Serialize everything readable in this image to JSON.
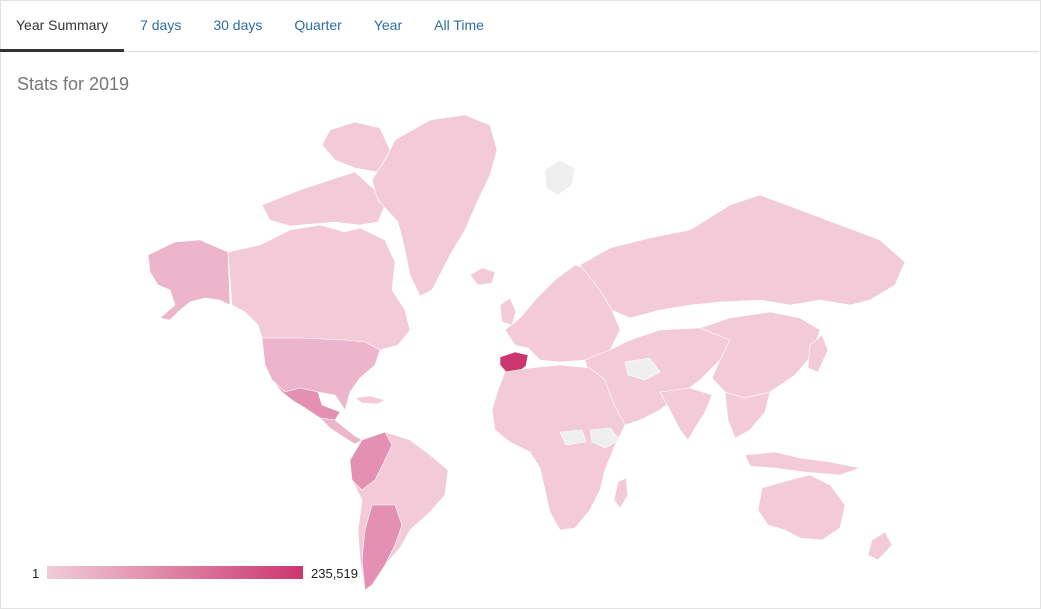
{
  "tabs": [
    {
      "label": "Year Summary",
      "active": true
    },
    {
      "label": "7 days",
      "active": false
    },
    {
      "label": "30 days",
      "active": false
    },
    {
      "label": "Quarter",
      "active": false
    },
    {
      "label": "Year",
      "active": false
    },
    {
      "label": "All Time",
      "active": false
    }
  ],
  "stats_title": "Stats for 2019",
  "legend": {
    "min_label": "1",
    "max_label": "235,519",
    "color_min": "#f0ccd9",
    "color_max": "#cc3670"
  },
  "map_colors": {
    "base": "#f2cad8",
    "americas_mid": "#ecb5cb",
    "americas_strong": "#e490b3",
    "peak": "#cc3670",
    "no_data": "#efefef"
  },
  "highlighted_country": "Spain"
}
